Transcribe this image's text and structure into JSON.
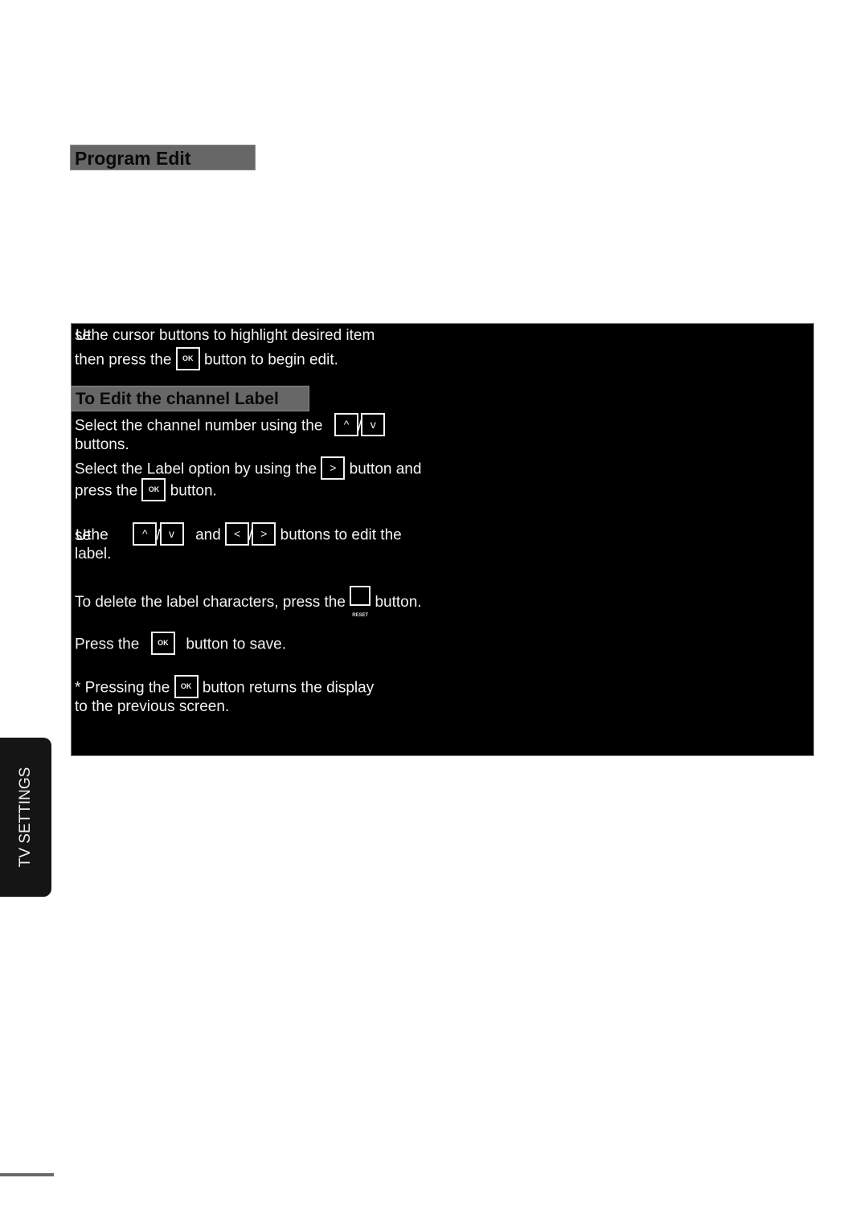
{
  "page": {
    "section_title": "Program Edit",
    "side_tab_label": "TV SETTINGS"
  },
  "panel": {
    "intro": {
      "line1_prefix_a": "se",
      "line1_prefix_b": "U",
      "line1_rest": " the cursor buttons to highlight desired item",
      "line2_before": "then press the",
      "line2_key": "OK",
      "line2_after": "button to begin edit."
    },
    "subheader": "To Edit the channel Label",
    "step1": {
      "before": "Select the channel number using the",
      "key_up": "^",
      "separator": "/",
      "key_down": "v",
      "line2": "buttons."
    },
    "step2": {
      "before": "Select the Label option by using the",
      "key_right": ">",
      "after": "button and",
      "line2_before": "press the",
      "line2_key": "OK",
      "line2_after": "button."
    },
    "step3": {
      "prefix_a": "se",
      "prefix_b": "U",
      "before": " the",
      "key_up": "^",
      "separator": "/",
      "key_down": "v",
      "middle": "and",
      "key_left": "<",
      "key_right": ">",
      "after": "buttons to edit the",
      "line2": "label."
    },
    "step4": {
      "before": "To delete the label characters, press the",
      "key_caption": "RESET",
      "after": "button."
    },
    "step5": {
      "before": "Press the",
      "key": "OK",
      "after": "button to save."
    },
    "note": {
      "before": "* Pressing the",
      "key": "OK",
      "after": "button returns the display",
      "line2": "to the previous screen."
    }
  }
}
